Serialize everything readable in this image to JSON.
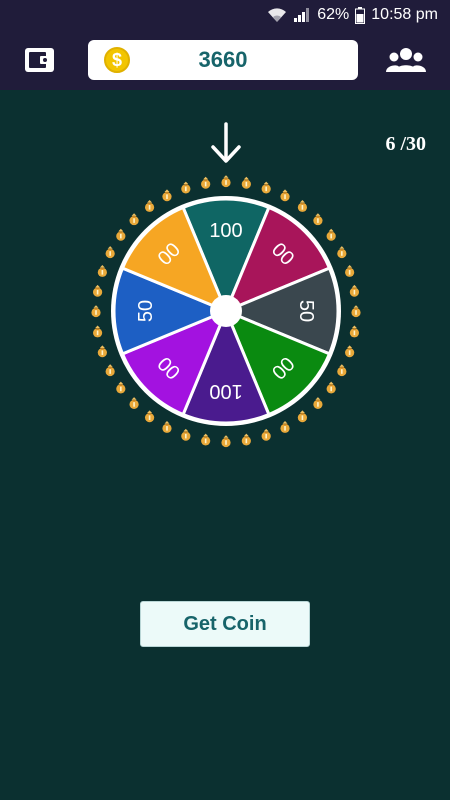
{
  "status_bar": {
    "battery_percent": "62%",
    "time": "10:58 pm",
    "icons": [
      "wifi-icon",
      "signal-icon",
      "battery-icon"
    ]
  },
  "header": {
    "wallet_icon": "wallet-icon",
    "coin_icon": "dollar-coin-icon",
    "coin_symbol": "$",
    "coin_balance": "3660",
    "group_icon": "people-group-icon"
  },
  "spin": {
    "pointer_icon": "down-arrow-icon",
    "current": "6",
    "separator": "/",
    "total": "30",
    "wheel_segments": [
      {
        "label": "100",
        "color": "#0f6664"
      },
      {
        "label": "00",
        "color": "#a8155a"
      },
      {
        "label": "50",
        "color": "#3a474e"
      },
      {
        "label": "00",
        "color": "#0a8a10"
      },
      {
        "label": "100",
        "color": "#4a1b8e"
      },
      {
        "label": "00",
        "color": "#a312e0"
      },
      {
        "label": "50",
        "color": "#1d5fc4"
      },
      {
        "label": "00",
        "color": "#f6a623"
      }
    ],
    "rim_icon": "money-bag-icon"
  },
  "actions": {
    "get_coin_label": "Get Coin"
  },
  "colors": {
    "background": "#0b3030",
    "header_bg": "#201c3a",
    "accent_text": "#17646a"
  }
}
